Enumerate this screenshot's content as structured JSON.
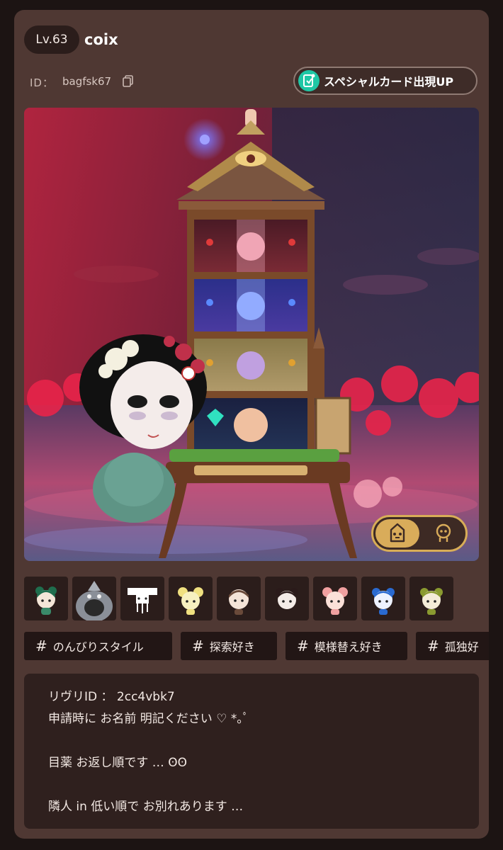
{
  "profile": {
    "level": "Lv.63",
    "username": "coix",
    "id_label": "ID：",
    "id_value": "bagfsk67",
    "special_button": "スペシャルカード出現UP"
  },
  "tags": [
    "のんびりスタイル",
    "探索好き",
    "模様替え好き",
    "孤独好"
  ],
  "bio": [
    "リヴリID ： 2cc4vbk7",
    "申請時に お名前 明記ください ♡ *｡ﾟ",
    "",
    "目薬 お返し順です … ʘʘ",
    "",
    "隣人 in 低い順で お別れあります …"
  ],
  "icons": {
    "copy": "copy-icon",
    "special": "card-icon",
    "toggle_left": "house-character-icon",
    "toggle_right": "character-face-icon"
  },
  "colors": {
    "card_bg": "#4f3833",
    "dark_panel": "#2b1d1b",
    "accent_gold": "#d9ac5a",
    "accent_teal": "#1fc7a5"
  }
}
